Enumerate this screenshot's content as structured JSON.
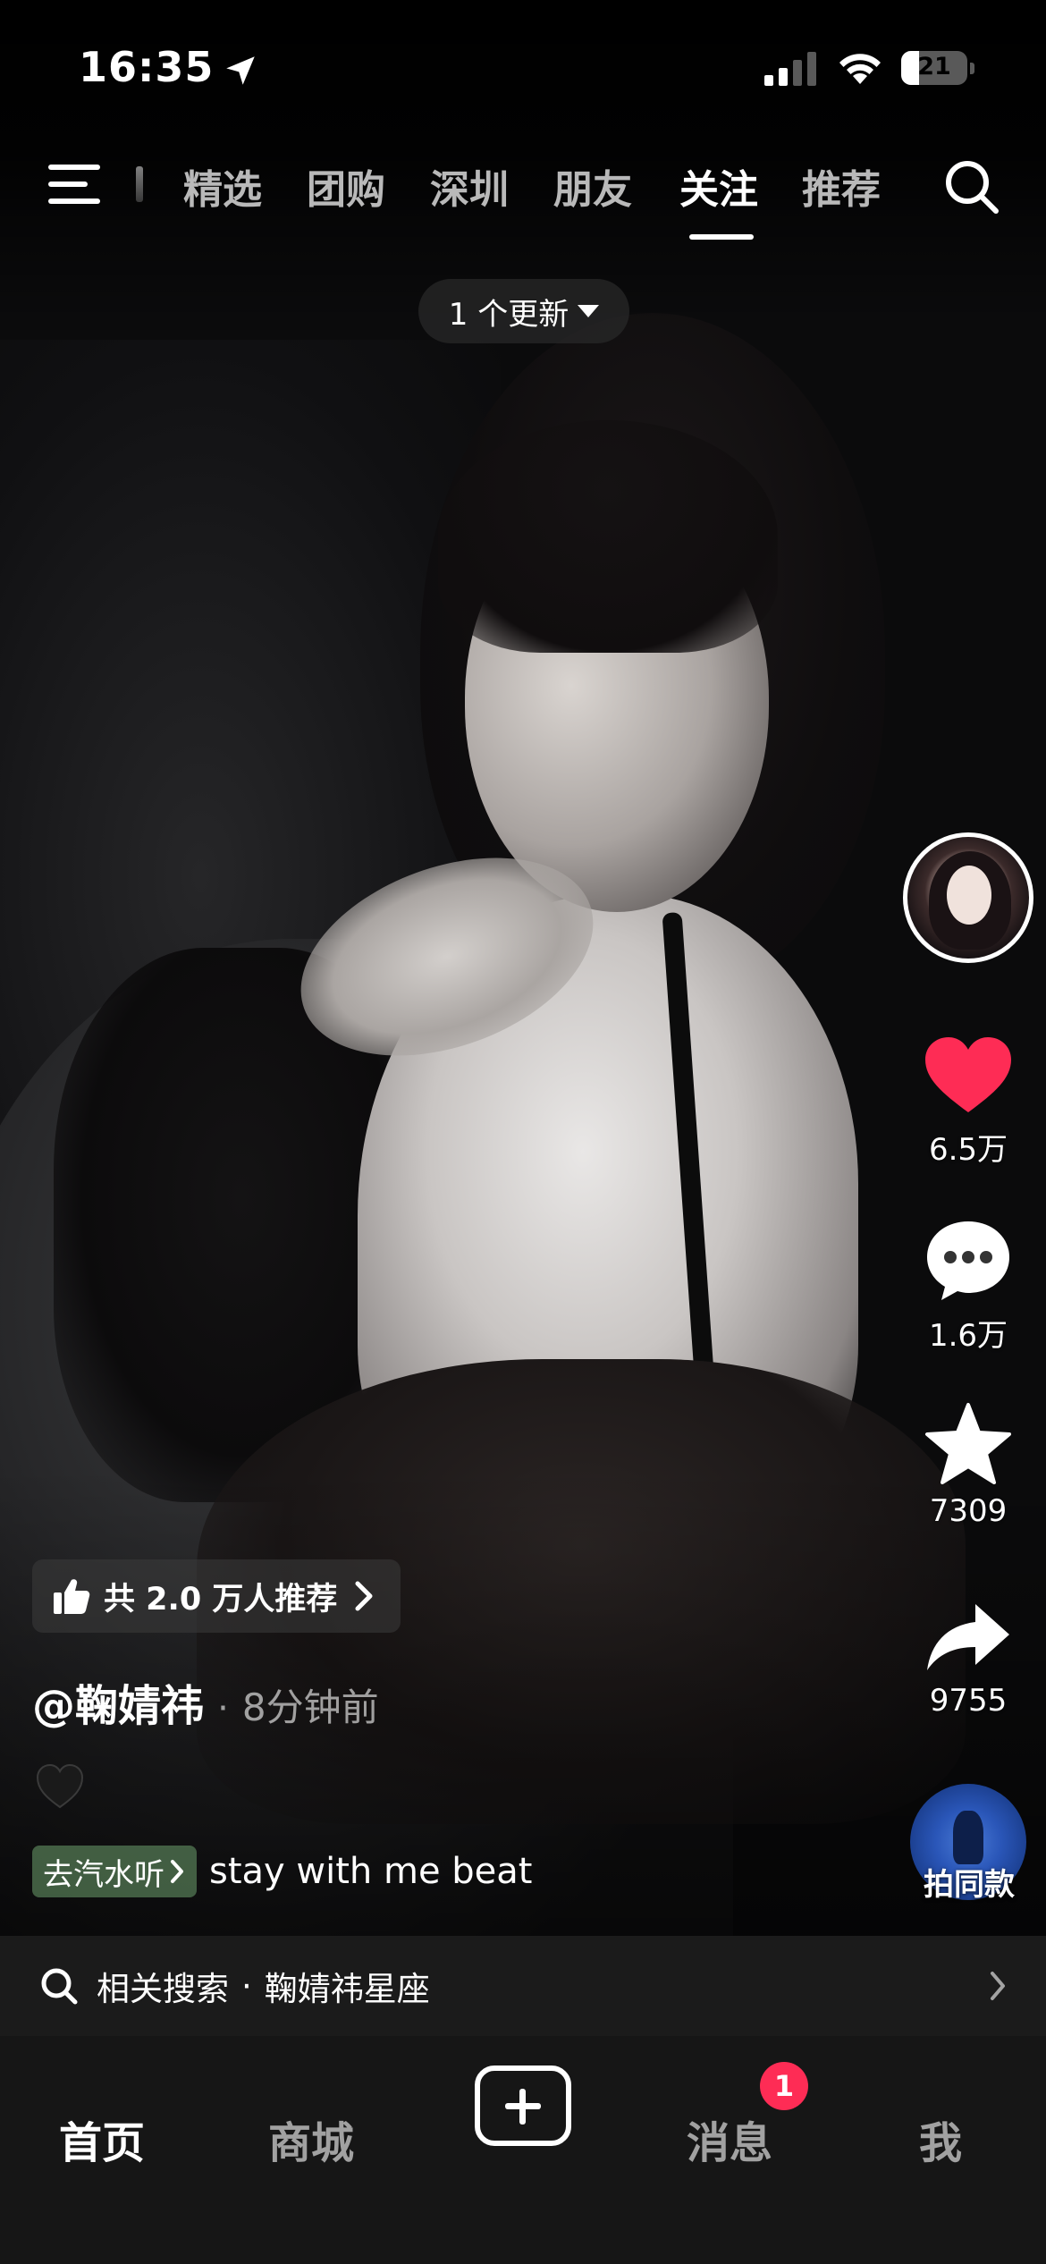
{
  "status_bar": {
    "time": "16:35",
    "battery": "21"
  },
  "top_nav": {
    "tabs": [
      "精选",
      "团购",
      "深圳",
      "朋友",
      "关注",
      "推荐"
    ],
    "active_tab": "关注"
  },
  "update_pill": {
    "label": "1 个更新"
  },
  "right_rail": {
    "likes": "6.5万",
    "comments": "1.6万",
    "favorites": "7309",
    "shares": "9755",
    "same_style_label": "拍同款"
  },
  "caption": {
    "recommend_label": "共 2.0 万人推荐",
    "author": "@鞠婧祎",
    "separator": "·",
    "time_ago": "8分钟前",
    "music_tag": "去汽水听",
    "music_name": "stay with me beat"
  },
  "related_search": {
    "label": "相关搜索",
    "separator": "·",
    "term": "鞠婧祎星座"
  },
  "bottom_nav": {
    "home": "首页",
    "mall": "商城",
    "messages": "消息",
    "me": "我",
    "messages_badge": "1"
  },
  "colors": {
    "like_red": "#fe2c55",
    "badge_red": "#fe2c55",
    "music_tag_green": "#6ea06e"
  },
  "icons": [
    "location-arrow-icon",
    "signal-icon",
    "wifi-icon",
    "battery-icon",
    "menu-icon",
    "search-icon",
    "heart-icon",
    "comment-icon",
    "star-icon",
    "share-icon",
    "thumbs-up-icon",
    "chevron-right-icon",
    "black-heart-icon",
    "plus-icon"
  ]
}
